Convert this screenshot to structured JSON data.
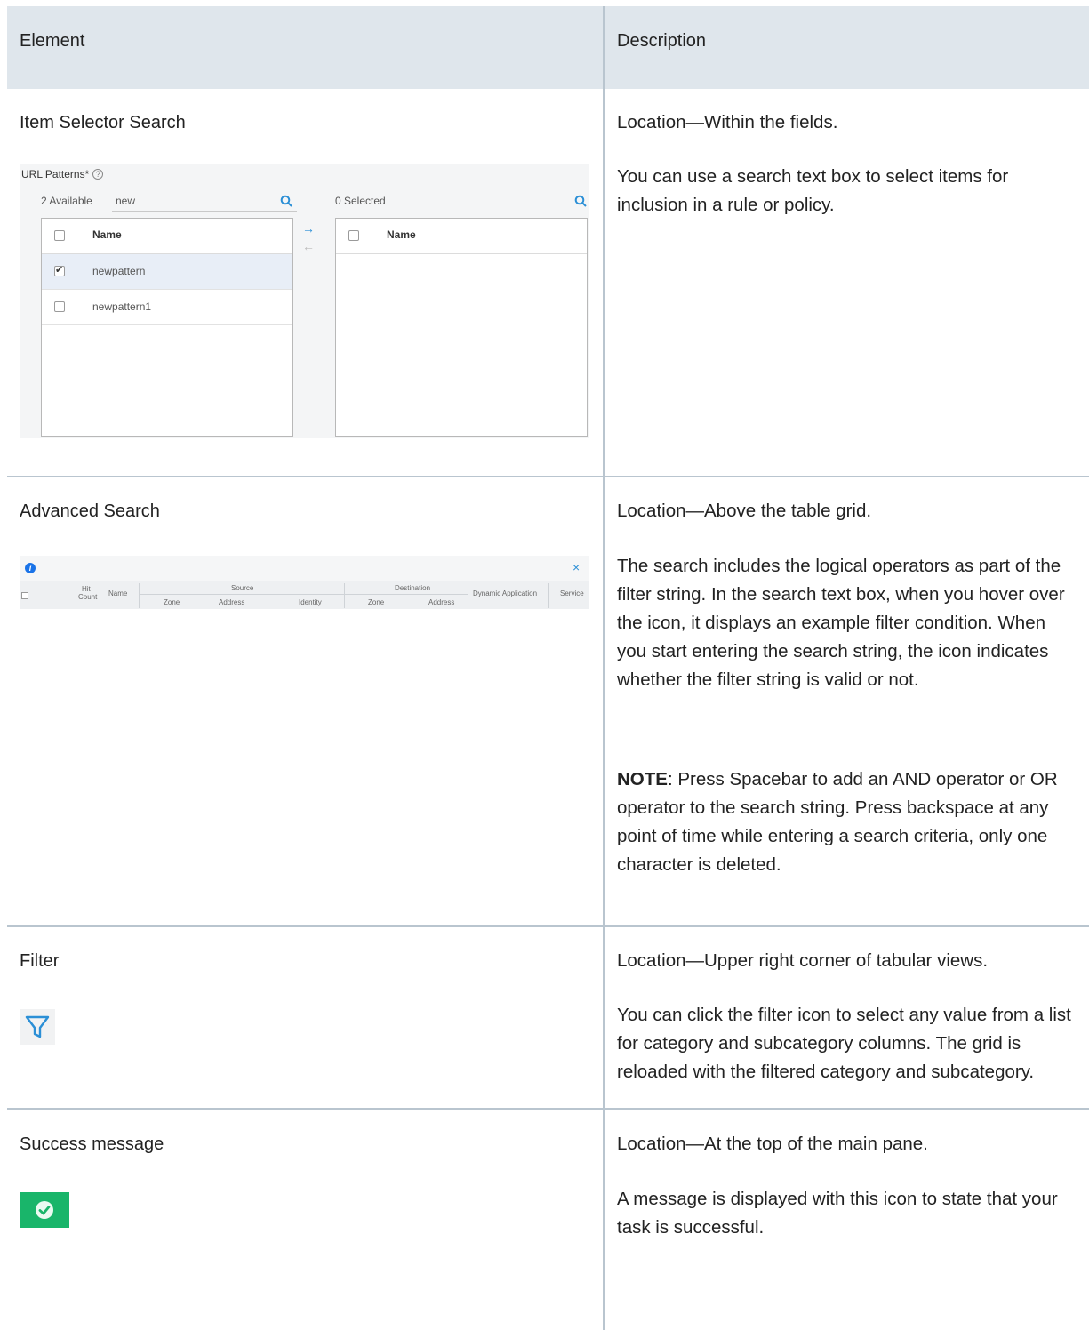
{
  "table": {
    "headers": [
      "Element",
      "Description"
    ],
    "rows": [
      {
        "element": "Item Selector Search",
        "location": "Location—Within the fields.",
        "description": "You can use a search text box to select items for inclusion in a rule or policy."
      },
      {
        "element": "Advanced Search",
        "location": "Location—Above the table grid.",
        "description": "The search includes the logical operators as part of the filter string. In the search text box, when you hover over the icon, it displays an example filter condition. When you start entering the search string, the icon indicates whether the filter string is valid or not.",
        "note_label": "NOTE",
        "note_text": ": Press Spacebar to add an AND operator or OR operator to the search string. Press backspace at any point of time while entering a search criteria, only one character is deleted."
      },
      {
        "element": "Filter",
        "location": "Location—Upper right corner of tabular views.",
        "description": "You can click the filter icon to select any value from a list for category and subcategory columns. The grid is reloaded with the filtered category and subcategory."
      },
      {
        "element": "Success message",
        "location": "Location—At the top of the main pane.",
        "description": "A message is displayed with this icon to state that your task is successful."
      }
    ]
  },
  "item_selector": {
    "label": "URL Patterns*",
    "help_glyph": "?",
    "available": "2 Available",
    "search_value": "new",
    "selected": "0 Selected",
    "column_header": "Name",
    "items": [
      {
        "name": "newpattern",
        "checked": true
      },
      {
        "name": "newpattern1",
        "checked": false
      }
    ],
    "arrow_add": "→",
    "arrow_remove": "←"
  },
  "advanced_grid": {
    "info_glyph": "i",
    "close_glyph": "×",
    "hit_count": [
      "Hit",
      "Count"
    ],
    "name": "Name",
    "source": "Source",
    "destination": "Destination",
    "dynamic_application": "Dynamic Application",
    "service": "Service",
    "zone": "Zone",
    "address": "Address",
    "identity": "Identity"
  },
  "icons": {
    "filter": "filter-icon",
    "success": "check-circle-icon",
    "accent": "#2b8fd6",
    "success_color": "#19b56a"
  }
}
